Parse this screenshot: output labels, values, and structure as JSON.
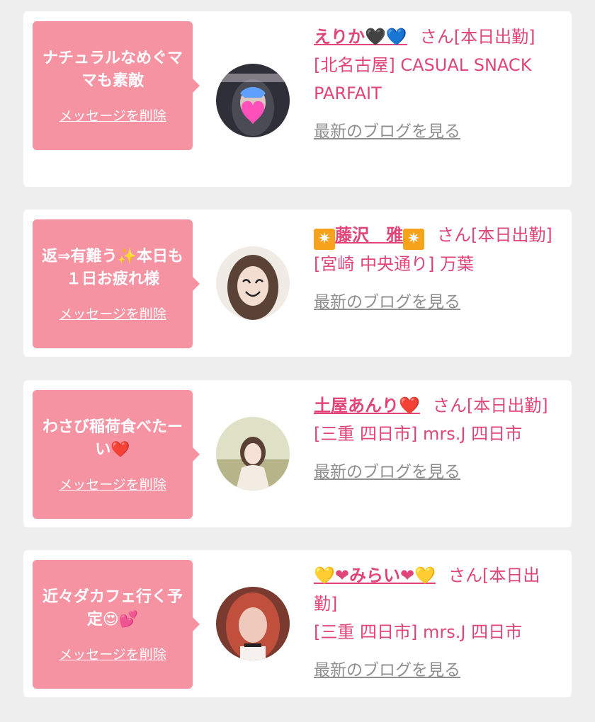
{
  "items": [
    {
      "message": "ナチュラルなめぐママも素敵",
      "delete_label": "メッセージを削除",
      "name": "えりか🖤💙",
      "honorific": "さん[本日出勤]",
      "location": "[北名古屋] CASUAL SNACK PARFAIT",
      "blog_link": "最新のブログを見る",
      "avatar_colors": [
        "#d9d0cf",
        "#3a3c47"
      ]
    },
    {
      "message": "返⇒有難う✨本日も１日お疲れ様",
      "delete_label": "メッセージを削除",
      "name": "藤沢　雅",
      "name_badge": "✷",
      "honorific": "さん[本日出勤]",
      "location": "[宮崎 中央通り] 万葉",
      "blog_link": "最新のブログを見る",
      "avatar_colors": [
        "#f1ebe6",
        "#5a4336"
      ]
    },
    {
      "message": "わさび稲荷食べたーい❤️",
      "delete_label": "メッセージを削除",
      "name": "土屋あんり❤️",
      "honorific": "さん[本日出勤]",
      "location": "[三重 四日市] mrs.J 四日市",
      "blog_link": "最新のブログを見る",
      "avatar_colors": [
        "#eef0e0",
        "#b8b58c"
      ]
    },
    {
      "message": "近々ダカフェ行く予定😍💕",
      "delete_label": "メッセージを削除",
      "name": "💛❤みらい❤💛",
      "honorific": "さん[本日出勤]",
      "location": "[三重 四日市] mrs.J 四日市",
      "blog_link": "最新のブログを見る",
      "avatar_colors": [
        "#e3b8a8",
        "#4a2420"
      ]
    }
  ]
}
